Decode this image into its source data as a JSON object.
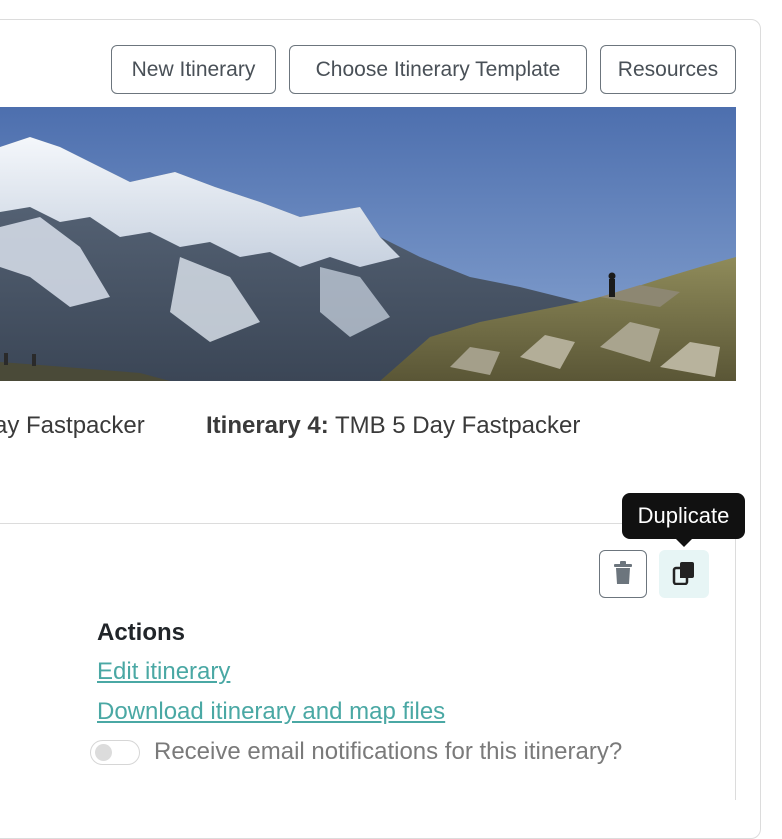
{
  "toolbar": {
    "new_itinerary": "New Itinerary",
    "choose_template": "Choose Itinerary Template",
    "resources": "Resources"
  },
  "itineraries": {
    "left_partial": "ay Fastpacker",
    "right_label": "Itinerary 4:",
    "right_name": "TMB 5 Day Fastpacker"
  },
  "tooltip": {
    "text": "Duplicate"
  },
  "card_icons": {
    "delete": "trash-icon",
    "duplicate": "copy-icon"
  },
  "actions": {
    "heading": "Actions",
    "edit_link": "Edit itinerary",
    "download_link": "Download itinerary and map files",
    "notifications_label": "Receive email notifications for this itinerary?",
    "notifications_enabled": false
  },
  "colors": {
    "link": "#4aa8a4",
    "tooltip_bg": "#111111",
    "duplicate_bg": "#e7f5f5"
  }
}
